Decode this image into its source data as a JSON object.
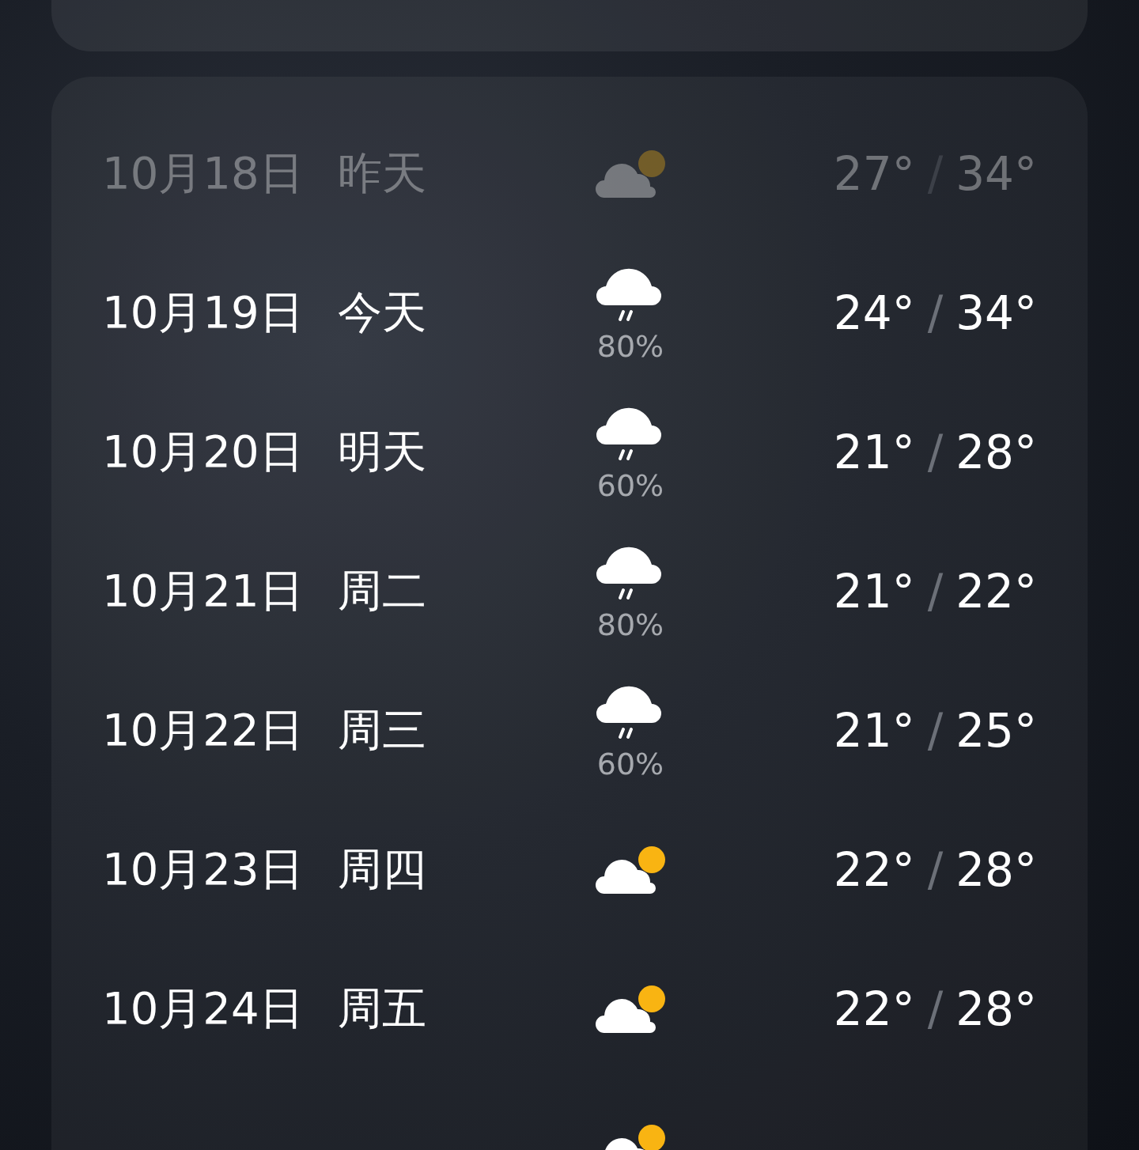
{
  "forecast": [
    {
      "date": "10月18日",
      "day": "昨天",
      "kind": "partly-cloudy",
      "past": true,
      "low": "27°",
      "high": "34°"
    },
    {
      "date": "10月19日",
      "day": "今天",
      "kind": "rain",
      "precip": "80%",
      "past": false,
      "low": "24°",
      "high": "34°"
    },
    {
      "date": "10月20日",
      "day": "明天",
      "kind": "rain",
      "precip": "60%",
      "past": false,
      "low": "21°",
      "high": "28°"
    },
    {
      "date": "10月21日",
      "day": "周二",
      "kind": "rain",
      "precip": "80%",
      "past": false,
      "low": "21°",
      "high": "22°"
    },
    {
      "date": "10月22日",
      "day": "周三",
      "kind": "rain",
      "precip": "60%",
      "past": false,
      "low": "21°",
      "high": "25°"
    },
    {
      "date": "10月23日",
      "day": "周四",
      "kind": "partly-cloudy",
      "past": false,
      "low": "22°",
      "high": "28°"
    },
    {
      "date": "10月24日",
      "day": "周五",
      "kind": "partly-cloudy",
      "past": false,
      "low": "22°",
      "high": "28°"
    },
    {
      "kind": "partly-cloudy",
      "past": false
    }
  ],
  "separator": "/"
}
